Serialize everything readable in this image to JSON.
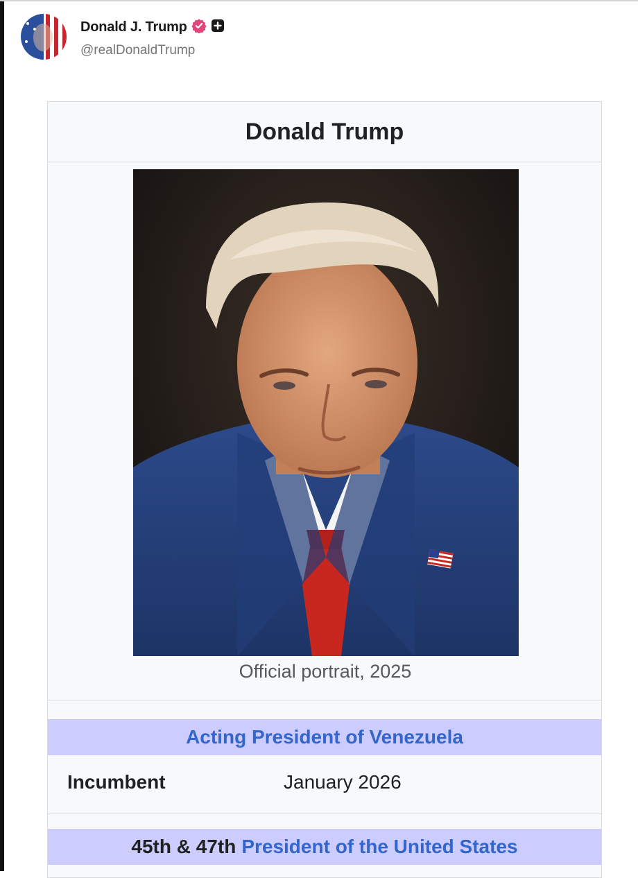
{
  "post": {
    "display_name": "Donald J. Trump",
    "handle": "@realDonaldTrump",
    "verified_icon": "verified-badge-icon",
    "plus_icon": "plus-square-icon",
    "accent_color": "#e0457b"
  },
  "infobox": {
    "title": "Donald Trump",
    "portrait_caption": "Official portrait, 2025",
    "office_1": {
      "header": "Acting President of Venezuela",
      "incumbent_label": "Incumbent",
      "incumbent_value": "January 2026"
    },
    "office_2": {
      "ordinal": "45th & 47th",
      "header_link": "President of the United States"
    },
    "colors": {
      "section_header_bg": "#ccccff",
      "link": "#3366cc"
    }
  }
}
